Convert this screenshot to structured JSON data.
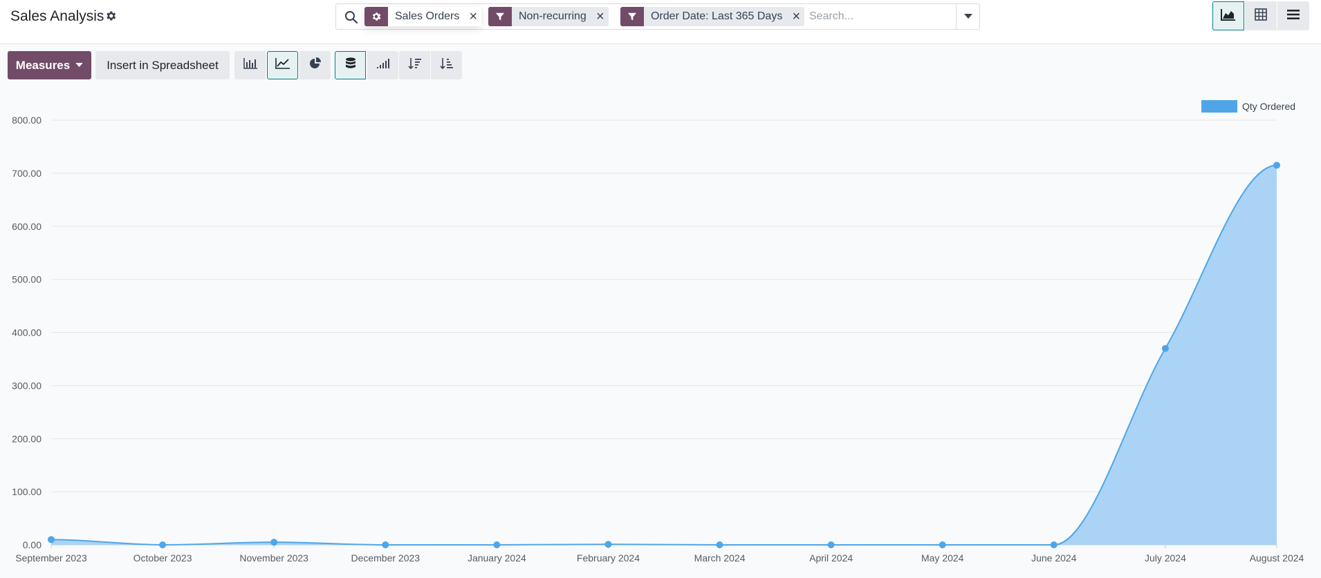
{
  "app": {
    "title": "Sales Analysis",
    "title_icon": "gear-icon"
  },
  "search": {
    "placeholder": "Search...",
    "facets": [
      {
        "icon": "gear-icon",
        "label": "Sales Orders"
      },
      {
        "icon": "filter-icon",
        "label": "Non-recurring"
      },
      {
        "icon": "filter-icon",
        "label": "Order Date: Last 365 Days"
      }
    ]
  },
  "views": [
    {
      "name": "graph-view",
      "icon": "area-chart-icon",
      "active": true
    },
    {
      "name": "pivot-view",
      "icon": "table-grid-icon",
      "active": false
    },
    {
      "name": "list-view",
      "icon": "list-icon",
      "active": false
    }
  ],
  "toolbar": {
    "measures_label": "Measures",
    "insert_label": "Insert in Spreadsheet",
    "chart_buttons": [
      {
        "name": "bar-chart",
        "icon": "bar-chart-icon",
        "active": false
      },
      {
        "name": "line-chart",
        "icon": "line-chart-icon",
        "active": true
      },
      {
        "name": "pie-chart",
        "icon": "pie-chart-icon",
        "active": false
      },
      {
        "name": "stacked",
        "icon": "database-icon",
        "active": true
      },
      {
        "name": "cumulative",
        "icon": "signal-icon",
        "active": false
      },
      {
        "name": "sort-descending",
        "icon": "sort-desc-icon",
        "active": false
      },
      {
        "name": "sort-ascending",
        "icon": "sort-asc-icon",
        "active": false
      }
    ]
  },
  "colors": {
    "brand": "#714b67",
    "series": "#4ea6e9",
    "series_fill": "#a6d1f5",
    "active_teal": "#017e84"
  },
  "chart_data": {
    "type": "area",
    "categories": [
      "September 2023",
      "October 2023",
      "November 2023",
      "December 2023",
      "January 2024",
      "February 2024",
      "March 2024",
      "April 2024",
      "May 2024",
      "June 2024",
      "July 2024",
      "August 2024"
    ],
    "series": [
      {
        "name": "Qty Ordered",
        "values": [
          10,
          0,
          5,
          0,
          0,
          1,
          0,
          0,
          0,
          0,
          370,
          715
        ]
      }
    ],
    "yticks": [
      "0.00",
      "100.00",
      "200.00",
      "300.00",
      "400.00",
      "500.00",
      "600.00",
      "700.00",
      "800.00"
    ],
    "ylim": [
      0,
      800
    ],
    "grid": true,
    "legend": "top-right"
  }
}
